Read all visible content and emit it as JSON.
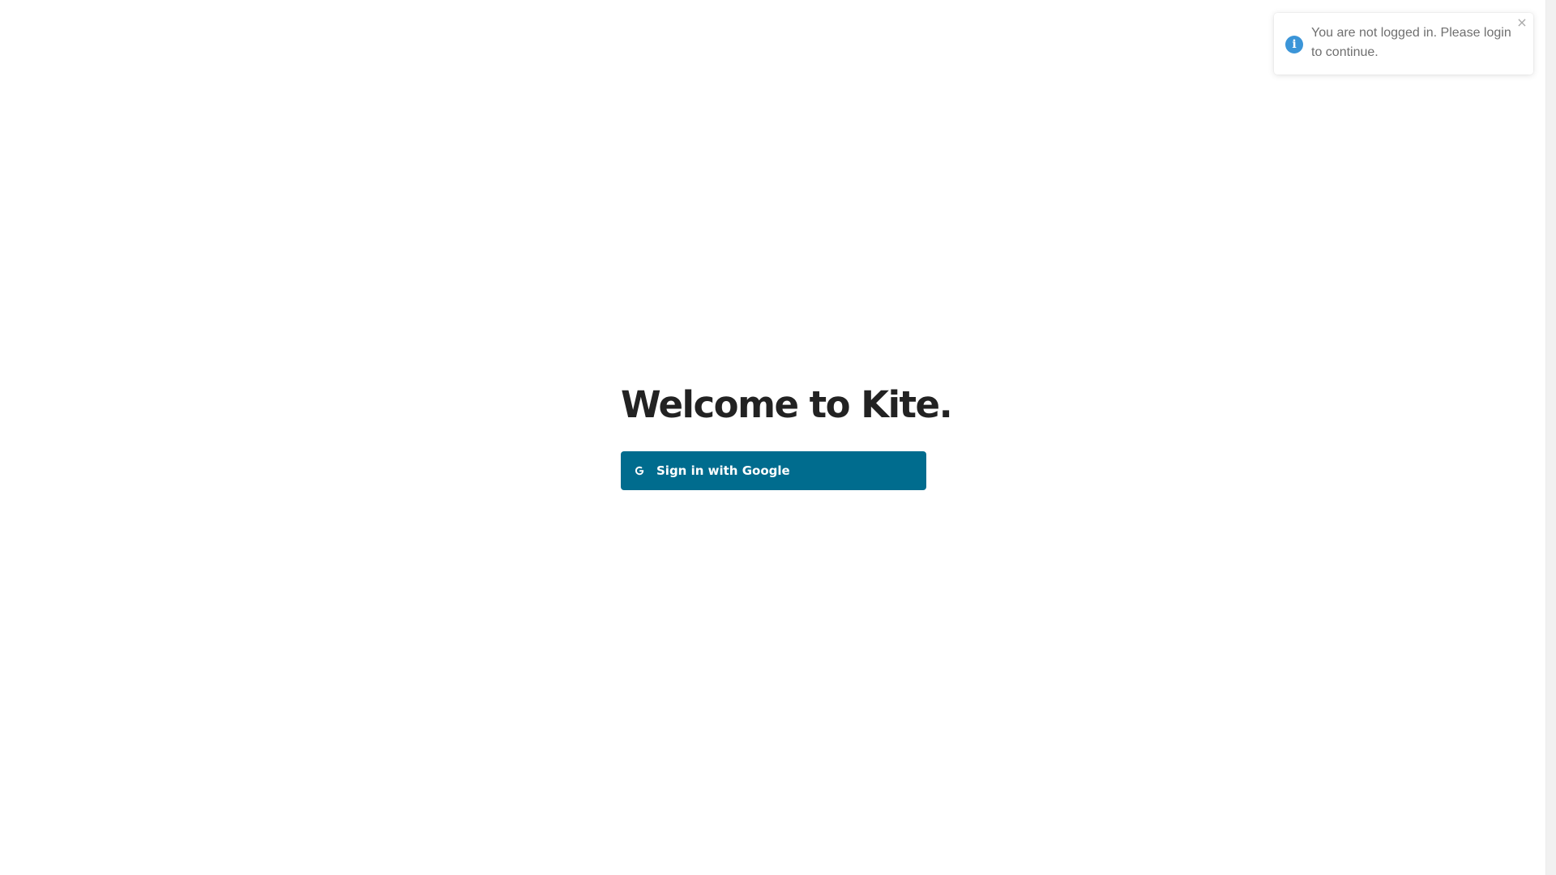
{
  "main": {
    "title": "Welcome to Kite.",
    "signin_button": {
      "label": "Sign in with Google",
      "icon": "google-icon",
      "background_color": "#006c8e"
    }
  },
  "toast": {
    "message": "You are not logged in. Please login to continue.",
    "icon": "info-icon",
    "icon_glyph": "i",
    "icon_color": "#3b95d8",
    "close_glyph": "×"
  }
}
